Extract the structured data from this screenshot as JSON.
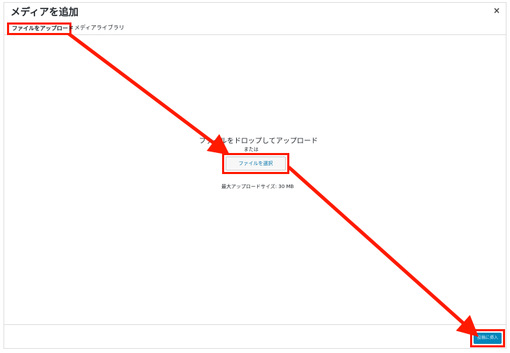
{
  "dialog": {
    "title": "メディアを追加",
    "close": "×"
  },
  "tabs": [
    {
      "label": "ファイルをアップロード",
      "active": true
    },
    {
      "label": "メディアライブラリ",
      "active": false
    }
  ],
  "upload": {
    "drop_text": "ファイルをドロップしてアップロード",
    "or_text": "または",
    "select_label": "ファイルを選択",
    "max_size": "最大アップロードサイズ: 30 MB"
  },
  "footer": {
    "insert_label": "投稿に挿入"
  },
  "colors": {
    "annotation": "#ff1a00",
    "primary_button": "#0085ba",
    "link": "#0073aa"
  }
}
